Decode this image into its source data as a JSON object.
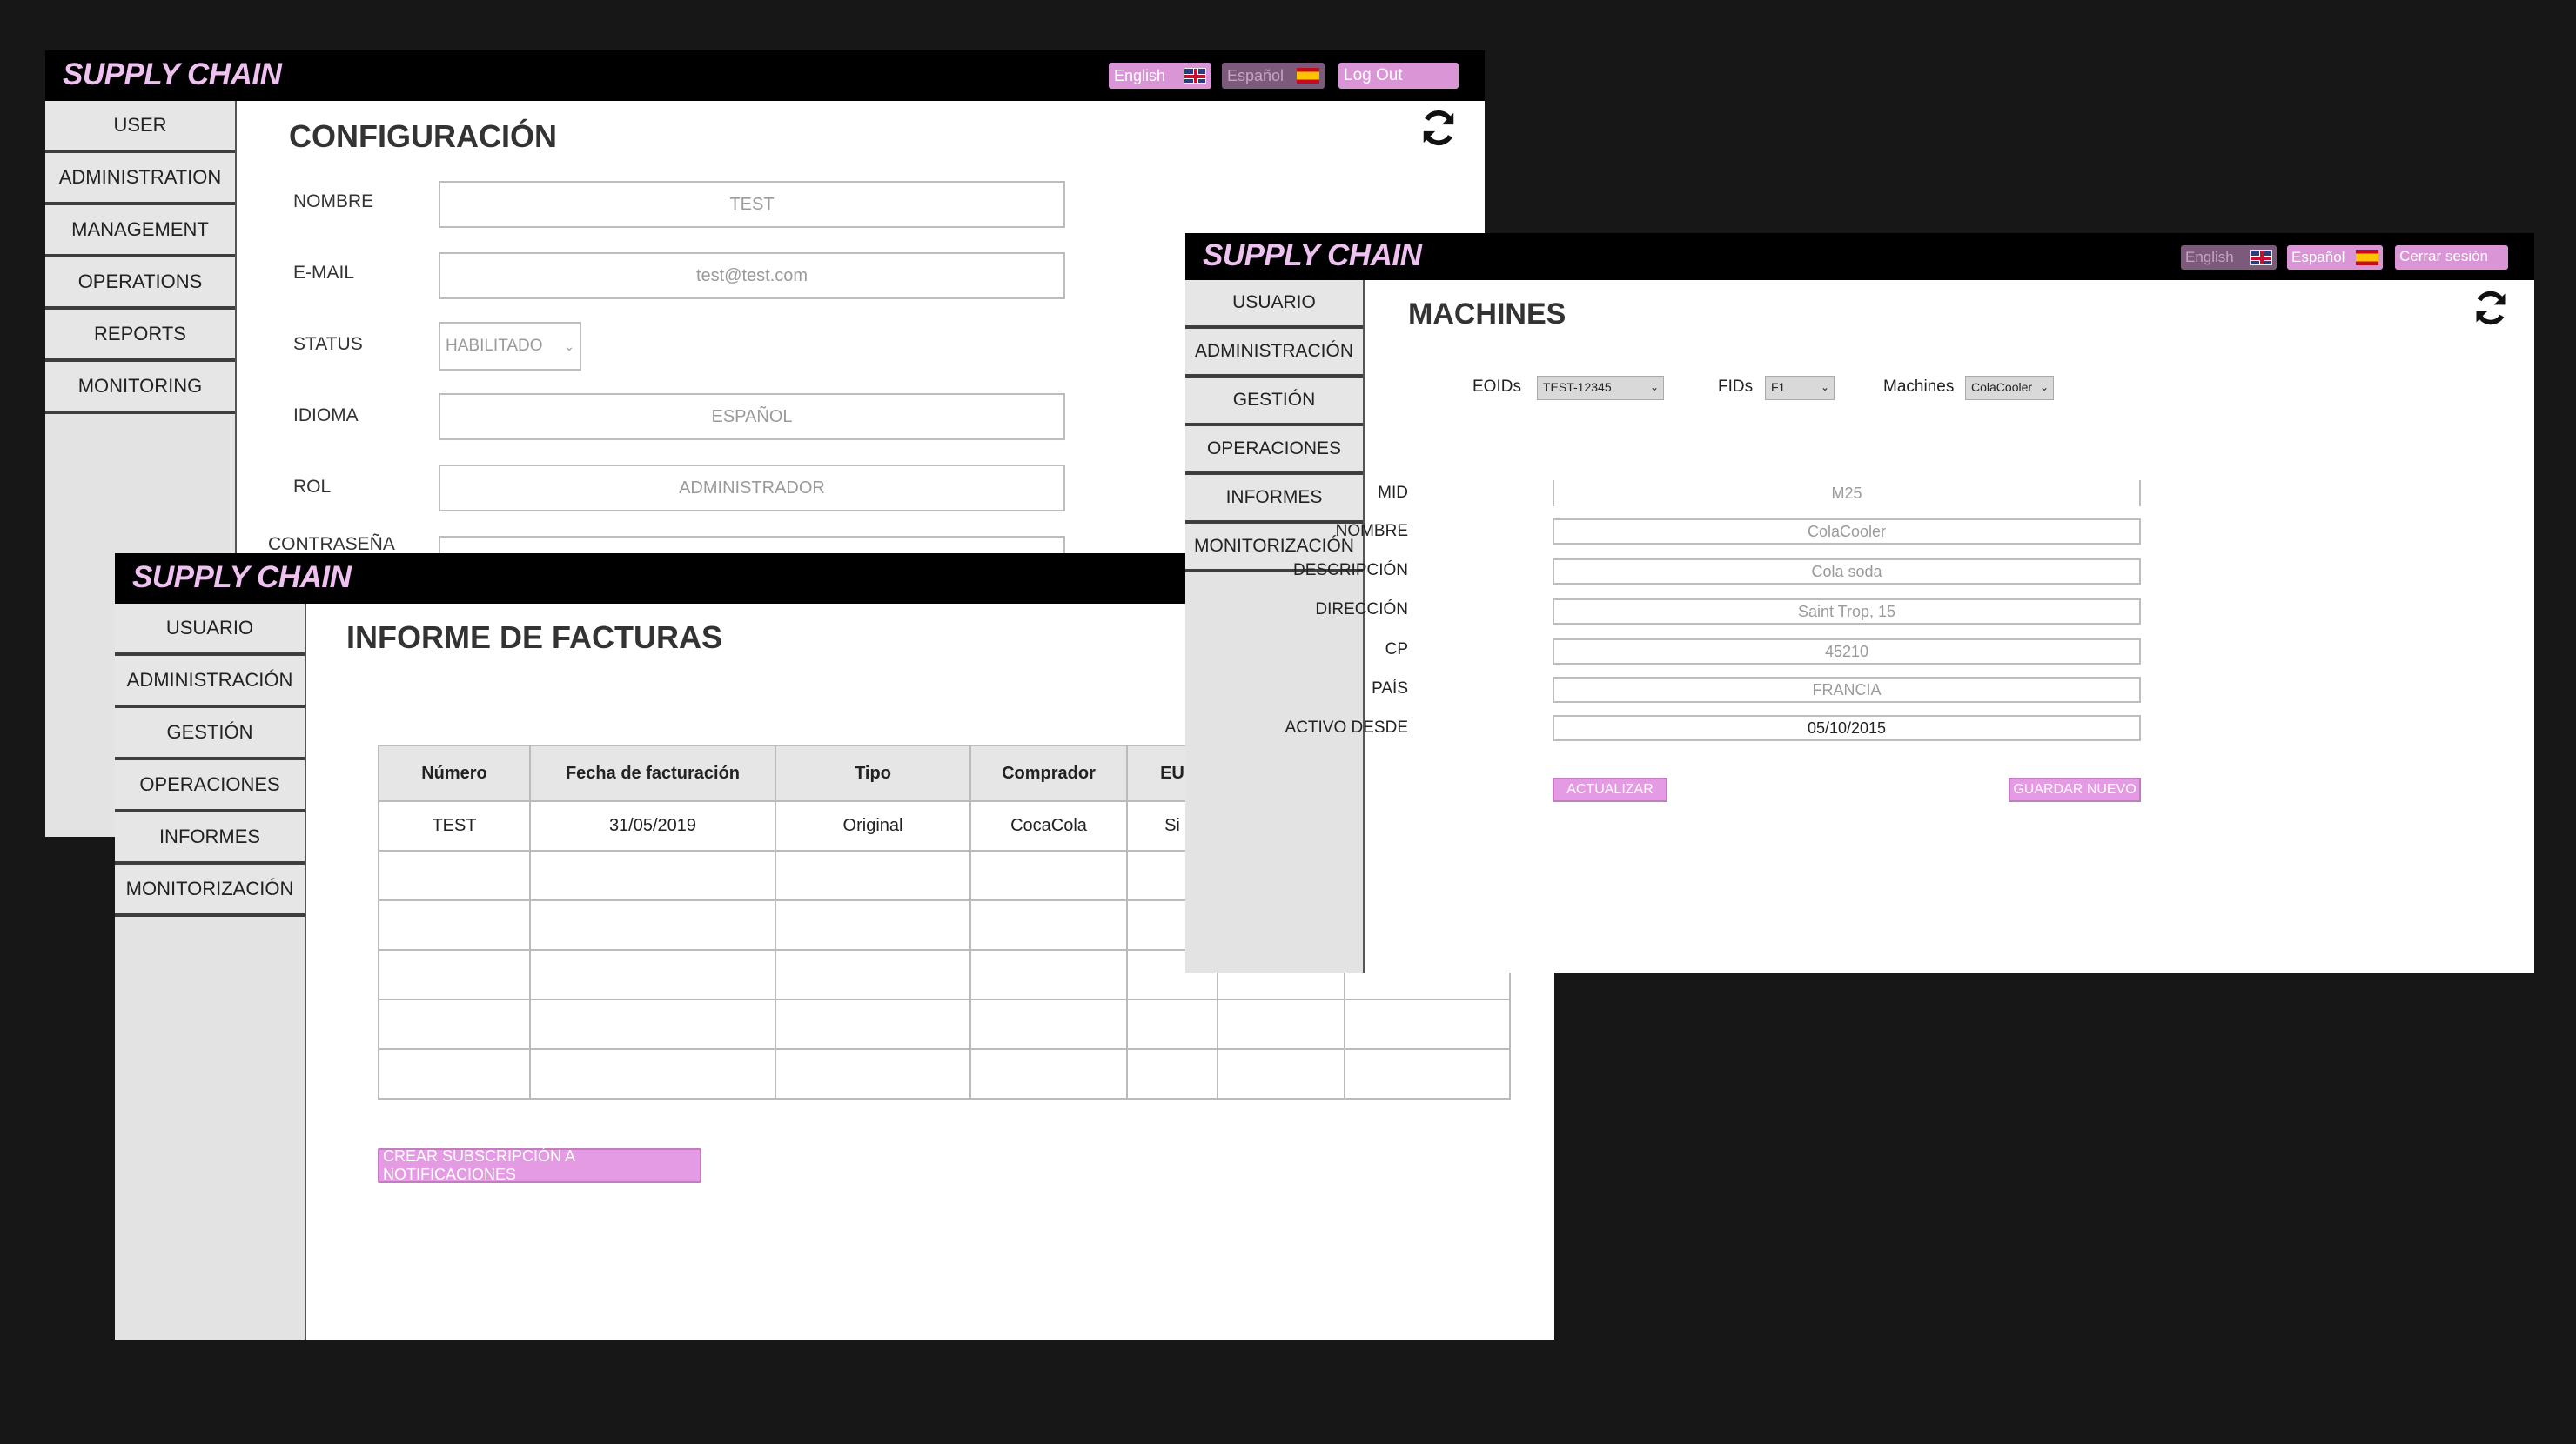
{
  "brand": "SUPPLY CHAIN",
  "config_window": {
    "lang_english": "English",
    "lang_spanish": "Español",
    "logout": "Log Out",
    "nav": [
      "USER",
      "ADMINISTRATION",
      "MANAGEMENT",
      "OPERATIONS",
      "REPORTS",
      "MONITORING"
    ],
    "title": "CONFIGURACIÓN",
    "fields": {
      "nombre_label": "NOMBRE",
      "nombre_value": "TEST",
      "email_label": "E-MAIL",
      "email_value": "test@test.com",
      "status_label": "STATUS",
      "status_value": "HABILITADO",
      "idioma_label": "IDIOMA",
      "idioma_value": "ESPAÑOL",
      "rol_label": "ROL",
      "rol_value": "ADMINISTRADOR",
      "password_label": "CONTRASEÑA"
    }
  },
  "invoice_window": {
    "nav": [
      "USUARIO",
      "ADMINISTRACIÓN",
      "GESTIÓN",
      "OPERACIONES",
      "INFORMES",
      "MONITORIZACIÓN"
    ],
    "title": "INFORME DE FACTURAS",
    "columns": [
      "Número",
      "Fecha de facturación",
      "Tipo",
      "Comprador",
      "EU"
    ],
    "rows": [
      [
        "TEST",
        "31/05/2019",
        "Original",
        "CocaCola",
        "Si"
      ]
    ],
    "subscribe_button": "CREAR SUBSCRIPCIÓN A  NOTIFICACIONES"
  },
  "machines_window": {
    "lang_english": "English",
    "lang_spanish": "Español",
    "logout": "Cerrar sesión",
    "nav": [
      "USUARIO",
      "ADMINISTRACIÓN",
      "GESTIÓN",
      "OPERACIONES",
      "INFORMES",
      "MONITORIZACIÓN"
    ],
    "title": "MACHINES",
    "filters": {
      "eoids_label": "EOIDs",
      "eoids_value": "TEST-12345",
      "fids_label": "FIDs",
      "fids_value": "F1",
      "machines_label": "Machines",
      "machines_value": "ColaCooler"
    },
    "fields": {
      "mid_label": "MID",
      "mid_value": "M25",
      "nombre_label": "NOMBRE",
      "nombre_value": "ColaCooler",
      "descripcion_label": "DESCRIPCIÓN",
      "descripcion_value": "Cola soda",
      "direccion_label": "DIRECCIÓN",
      "direccion_value": "Saint Trop, 15",
      "cp_label": "CP",
      "cp_value": "45210",
      "pais_label": "PAÍS",
      "pais_value": "FRANCIA",
      "activo_label": "ACTIVO DESDE",
      "activo_value": "05/10/2015"
    },
    "update_button": "ACTUALIZAR",
    "save_new_button": "GUARDAR NUEVO"
  }
}
